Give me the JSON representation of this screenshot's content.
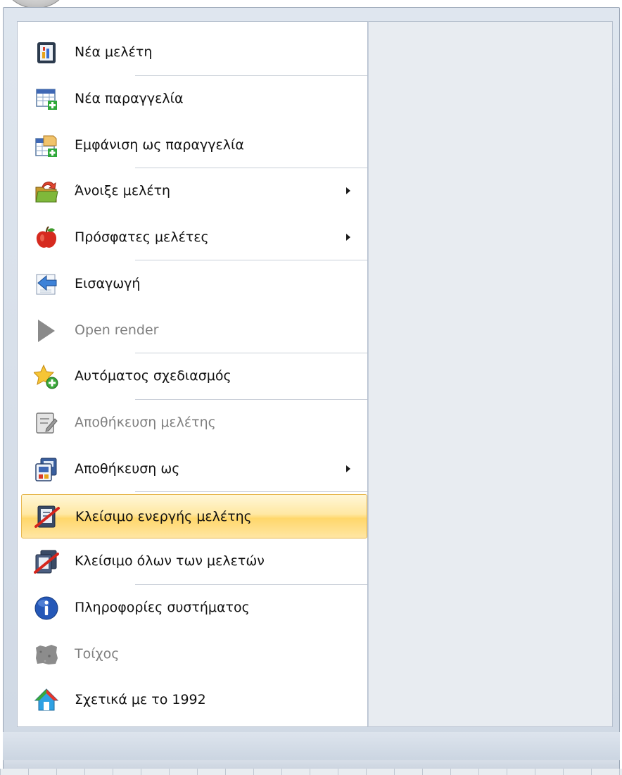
{
  "menu": {
    "items": [
      {
        "label": "Νέα μελέτη",
        "icon": "new-study-icon"
      },
      {
        "label": "Νέα παραγγελία",
        "icon": "new-order-icon"
      },
      {
        "label": "Εμφάνιση ως παραγγελία",
        "icon": "show-as-order-icon"
      },
      {
        "label": "Άνοιξε μελέτη",
        "icon": "open-folder-icon",
        "submenu": true
      },
      {
        "label": "Πρόσφατες μελέτες",
        "icon": "apple-icon",
        "submenu": true
      },
      {
        "label": "Εισαγωγή",
        "icon": "import-arrow-icon"
      },
      {
        "label": "Open render",
        "icon": "play-icon",
        "disabled": true
      },
      {
        "label": "Αυτόματος σχεδιασμός",
        "icon": "star-add-icon"
      },
      {
        "label": "Αποθήκευση μελέτης",
        "icon": "save-study-icon",
        "disabled": true
      },
      {
        "label": "Αποθήκευση ως",
        "icon": "save-as-icon",
        "submenu": true
      },
      {
        "label": "Κλείσιμο ενεργής μελέτης",
        "icon": "close-study-icon",
        "highlighted": true
      },
      {
        "label": "Κλείσιμο όλων των μελετών",
        "icon": "close-all-studies-icon"
      },
      {
        "label": "Πληροφορίες συστήματος",
        "icon": "info-icon"
      },
      {
        "label": "Τοίχος",
        "icon": "wall-icon",
        "disabled": true
      },
      {
        "label": "Σχετικά με το 1992",
        "icon": "about-house-icon"
      }
    ]
  },
  "colors": {
    "highlight": "#ffd76b",
    "disabled_text": "#7f7f7f",
    "pane_border": "#b7c1cf"
  }
}
